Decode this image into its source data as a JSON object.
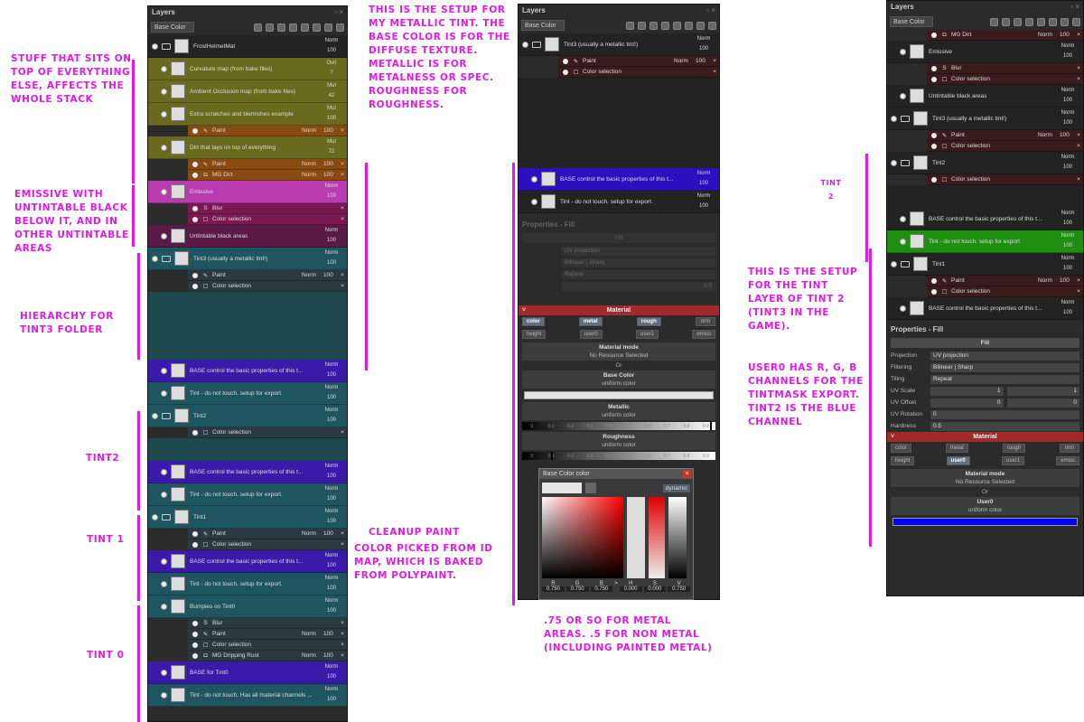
{
  "notes": {
    "top_stack": "Stuff that sits on top of everything else, affects the whole stack",
    "emissive": "Emissive with untintable black below it, and in other untintable areas",
    "hierarchy": "Hierarchy for Tint3 folder",
    "tint2": "Tint2",
    "tint1": "Tint 1",
    "tint0": "Tint 0",
    "metallic_setup": "This is the setup for my metallic tint. The base color is for the diffuse texture. Metallic is for metalness or spec. Roughness for roughness.",
    "cleanup": "Cleanup paint",
    "color_picked": "Color picked from ID map, which is baked from polypaint.",
    "metal_values": ".75 or so for metal areas. .5 for non metal (including painted metal)",
    "tint2_right": "Tint 2",
    "tint_layer_setup": "This is the setup for the tint layer of Tint 2 (Tint3 in the game).",
    "user0": "User0 has R, G, B channels for the tintmask export. Tint2 is the blue channel"
  },
  "panel_left": {
    "title": "Layers",
    "channel": "Base Color",
    "rows": [
      {
        "type": "layer",
        "name": "FrostHelmetMat",
        "blend": "Norm",
        "opacity": "100",
        "cls": "dk",
        "folder": true
      },
      {
        "type": "layer",
        "name": "Curvature map (from bake files)",
        "blend": "Ovrl",
        "opacity": "7",
        "cls": "y1"
      },
      {
        "type": "layer",
        "name": "Ambient Occlusion map (from bake files)",
        "blend": "Mul",
        "opacity": "42",
        "cls": "y1"
      },
      {
        "type": "layer",
        "name": "Extra scratches and blemishes example",
        "blend": "Mul",
        "opacity": "100",
        "cls": "y1"
      },
      {
        "type": "sub",
        "icon": "✎",
        "name": "Paint",
        "blend": "Norm",
        "opacity": "100",
        "cls": "y2"
      },
      {
        "type": "layer",
        "name": "Dirt that lays on top of everything",
        "blend": "Mul",
        "opacity": "72",
        "cls": "y1"
      },
      {
        "type": "sub",
        "icon": "✎",
        "name": "Paint",
        "blend": "Norm",
        "opacity": "100",
        "cls": "y2"
      },
      {
        "type": "sub",
        "icon": "◘",
        "name": "MG Dirt",
        "blend": "Norm",
        "opacity": "100",
        "cls": "y2"
      },
      {
        "type": "layer",
        "name": "Emissive",
        "blend": "Norm",
        "opacity": "100",
        "cls": "m1"
      },
      {
        "type": "sub",
        "icon": "S",
        "name": "Blur",
        "blend": "",
        "opacity": "",
        "cls": "m2"
      },
      {
        "type": "sub",
        "icon": "☐",
        "name": "Color selection",
        "blend": "",
        "opacity": "",
        "cls": "m2"
      },
      {
        "type": "layer",
        "name": "Untintable black areas",
        "blend": "Norm",
        "opacity": "100",
        "cls": "m3"
      },
      {
        "type": "layer",
        "name": "Tint3 (usually a metallic tint!)",
        "blend": "Norm",
        "opacity": "100",
        "cls": "t1",
        "folder": true
      },
      {
        "type": "sub",
        "icon": "✎",
        "name": "Paint",
        "blend": "Norm",
        "opacity": "100",
        "cls": "t2"
      },
      {
        "type": "sub",
        "icon": "☐",
        "name": "Color selection",
        "blend": "",
        "opacity": "",
        "cls": "t2"
      },
      {
        "type": "faded",
        "cls": "tf"
      },
      {
        "type": "layer",
        "name": "BASE control the basic properties of this t...",
        "blend": "Norm",
        "opacity": "100",
        "cls": "pu"
      },
      {
        "type": "layer",
        "name": "Tint - do not touch. setup for export.",
        "blend": "Norm",
        "opacity": "100",
        "cls": "t1"
      },
      {
        "type": "layer",
        "name": "Tint2",
        "blend": "Norm",
        "opacity": "100",
        "cls": "t1",
        "folder": true
      },
      {
        "type": "sub",
        "icon": "☐",
        "name": "Color selection",
        "blend": "",
        "opacity": "",
        "cls": "t2"
      },
      {
        "type": "fadedsmall",
        "cls": "tf"
      },
      {
        "type": "layer",
        "name": "BASE control the basic properties of this t...",
        "blend": "Norm",
        "opacity": "100",
        "cls": "pu"
      },
      {
        "type": "layer",
        "name": "Tint - do not touch. setup for export.",
        "blend": "Norm",
        "opacity": "100",
        "cls": "t1"
      },
      {
        "type": "layer",
        "name": "Tint1",
        "blend": "Norm",
        "opacity": "100",
        "cls": "t1",
        "folder": true
      },
      {
        "type": "sub",
        "icon": "✎",
        "name": "Paint",
        "blend": "Norm",
        "opacity": "100",
        "cls": "t2"
      },
      {
        "type": "sub",
        "icon": "☐",
        "name": "Color selection",
        "blend": "",
        "opacity": "",
        "cls": "t2"
      },
      {
        "type": "layer",
        "name": "BASE control the basic properties of this t...",
        "blend": "Norm",
        "opacity": "100",
        "cls": "pu"
      },
      {
        "type": "layer",
        "name": "Tint - do not touch. setup for export.",
        "blend": "Norm",
        "opacity": "100",
        "cls": "t1"
      },
      {
        "type": "layer",
        "name": "Bumpies on Tint0",
        "blend": "Norm",
        "opacity": "100",
        "cls": "t1"
      },
      {
        "type": "sub",
        "icon": "S",
        "name": "Blur",
        "blend": "",
        "opacity": "",
        "cls": "t2"
      },
      {
        "type": "sub",
        "icon": "✎",
        "name": "Paint",
        "blend": "Norm",
        "opacity": "100",
        "cls": "t2"
      },
      {
        "type": "sub",
        "icon": "☐",
        "name": "Color selection",
        "blend": "",
        "opacity": "",
        "cls": "t2"
      },
      {
        "type": "sub",
        "icon": "◘",
        "name": "MG Dripping Rust",
        "blend": "Norm",
        "opacity": "100",
        "cls": "t2"
      },
      {
        "type": "layer",
        "name": "BASE for Tint0",
        "blend": "Norm",
        "opacity": "100",
        "cls": "pu"
      },
      {
        "type": "layer",
        "name": "Tint - do not touch. Has all material channels ...",
        "blend": "Norm",
        "opacity": "100",
        "cls": "t1"
      }
    ]
  },
  "panel_mid": {
    "title": "Layers",
    "channel": "Base Color",
    "rows": [
      {
        "type": "layer",
        "name": "Tint3 (usually a metallic tint!)",
        "blend": "Norm",
        "opacity": "100",
        "cls": "dk",
        "folder": true
      },
      {
        "type": "sub",
        "icon": "✎",
        "name": "Paint",
        "blend": "Norm",
        "opacity": "100",
        "cls": "dk2"
      },
      {
        "type": "sub",
        "icon": "☐",
        "name": "Color selection",
        "blend": "",
        "opacity": "",
        "cls": "dk2"
      },
      {
        "type": "fadedbig",
        "cls": "dk"
      },
      {
        "type": "layer",
        "name": "BASE control the basic properties of this t...",
        "blend": "Norm",
        "opacity": "100",
        "cls": "pu2"
      },
      {
        "type": "layer",
        "name": "Tint - do not touch. setup for export.",
        "blend": "Norm",
        "opacity": "100",
        "cls": "dk"
      }
    ],
    "props_title": "Properties - Fill",
    "fill_faded": "Fill",
    "projection_faded": "UV projection",
    "filtering_faded": "Bilinear | Sharp",
    "tiling_faded": "Repeat",
    "hardness_value": "0.5",
    "material": {
      "title": "Material",
      "row1": [
        "color",
        "metal",
        "rough",
        "nrm"
      ],
      "row2": [
        "height",
        "user0",
        "user1",
        "emiss"
      ],
      "mode_label": "Material mode",
      "mode_value": "No Resource Selected",
      "or": "Or",
      "base_color_label": "Base Color",
      "base_color_sub": "uniform color",
      "metallic_label": "Metallic",
      "metallic_sub": "uniform color",
      "metallic_value": 0.97,
      "roughness_label": "Roughness",
      "roughness_sub": "uniform color",
      "roughness_value": 0.15,
      "ticks": [
        "0",
        "0.1",
        "0.2",
        "0.3",
        "0.4",
        "0.5",
        "0.6",
        "0.7",
        "0.8",
        "0.9"
      ]
    },
    "color_dialog": {
      "title": "Base Color color",
      "mode": "dynamic",
      "labels": [
        "R",
        "G",
        "B",
        "H",
        "S",
        "V"
      ],
      "values": [
        "0.750",
        "0.750",
        "0.750",
        "0.000",
        "0.000",
        "0.750"
      ],
      "arrow": ">"
    }
  },
  "panel_right": {
    "title": "Layers",
    "channel": "Base Color",
    "rows": [
      {
        "type": "sub",
        "icon": "◘",
        "name": "MG Dirt",
        "blend": "Norm",
        "opacity": "100",
        "cls": "dk2"
      },
      {
        "type": "layer",
        "name": "Emissive",
        "blend": "Norm",
        "opacity": "100",
        "cls": "dk"
      },
      {
        "type": "sub",
        "icon": "S",
        "name": "Blur",
        "blend": "",
        "opacity": "",
        "cls": "dk2"
      },
      {
        "type": "sub",
        "icon": "☐",
        "name": "Color selection",
        "blend": "",
        "opacity": "",
        "cls": "dk2"
      },
      {
        "type": "layer",
        "name": "Untintable black areas",
        "blend": "Norm",
        "opacity": "100",
        "cls": "dk"
      },
      {
        "type": "layer",
        "name": "Tint3 (usually a metallic tint!)",
        "blend": "Norm",
        "opacity": "100",
        "cls": "dk",
        "folder": true
      },
      {
        "type": "sub",
        "icon": "✎",
        "name": "Paint",
        "blend": "Norm",
        "opacity": "100",
        "cls": "dk2"
      },
      {
        "type": "sub",
        "icon": "☐",
        "name": "Color selection",
        "blend": "",
        "opacity": "",
        "cls": "dk2"
      },
      {
        "type": "layer",
        "name": "Tint2",
        "blend": "Norm",
        "opacity": "100",
        "cls": "dk",
        "folder": true
      },
      {
        "type": "sub",
        "icon": "☐",
        "name": "Color selection",
        "blend": "",
        "opacity": "",
        "cls": "dk2"
      },
      {
        "type": "fadedsmall",
        "cls": "dk"
      },
      {
        "type": "layer",
        "name": "BASE control the basic properties of this t...",
        "blend": "Norm",
        "opacity": "100",
        "cls": "dk"
      },
      {
        "type": "layer",
        "name": "Tint - do not touch. setup for export.",
        "blend": "Norm",
        "opacity": "100",
        "cls": "gr"
      },
      {
        "type": "layer",
        "name": "Tint1",
        "blend": "Norm",
        "opacity": "100",
        "cls": "dk",
        "folder": true
      },
      {
        "type": "sub",
        "icon": "✎",
        "name": "Paint",
        "blend": "Norm",
        "opacity": "100",
        "cls": "dk2"
      },
      {
        "type": "sub",
        "icon": "☐",
        "name": "Color selection",
        "blend": "",
        "opacity": "",
        "cls": "dk2"
      },
      {
        "type": "layer",
        "name": "BASE control the basic properties of this t...",
        "blend": "Norm",
        "opacity": "100",
        "cls": "dk"
      }
    ],
    "props_title": "Properties - Fill",
    "fill": "Fill",
    "props": [
      {
        "label": "Projection",
        "value": "UV projection"
      },
      {
        "label": "Filtering",
        "value": "Bilinear | Sharp"
      },
      {
        "label": "Tiling",
        "value": "Repeat"
      },
      {
        "label": "UV Scale",
        "value": "1",
        "value2": "1"
      },
      {
        "label": "UV Offset",
        "value": "0",
        "value2": "0"
      },
      {
        "label": "UV Rotation",
        "value": "0"
      },
      {
        "label": "Hardness",
        "value": "0.5"
      }
    ],
    "material": {
      "title": "Material",
      "row1": [
        "color",
        "metal",
        "rough",
        "nrm"
      ],
      "row2": [
        "height",
        "user0",
        "user1",
        "emiss"
      ],
      "active": "user0",
      "mode_label": "Material mode",
      "mode_value": "No Resource Selected",
      "or": "Or",
      "user0_label": "User0",
      "user0_sub": "uniform color",
      "user0_color": "#0000ff"
    }
  }
}
